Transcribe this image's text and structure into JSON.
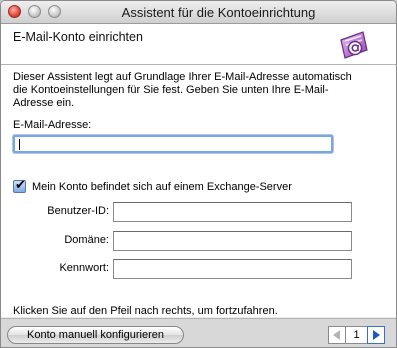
{
  "window": {
    "title": "Assistent für die Kontoeinrichtung"
  },
  "header": {
    "title": "E-Mail-Konto einrichten",
    "logo_icon": "entourage-logo-icon"
  },
  "content": {
    "description": "Dieser Assistent legt auf Grundlage Ihrer E-Mail-Adresse automatisch die Kontoeinstellungen für Sie fest. Geben Sie unten Ihre E-Mail-Adresse ein.",
    "email_label": "E-Mail-Adresse:",
    "email_value": "",
    "exchange_checkbox": {
      "label": "Mein Konto befindet sich auf einem Exchange-Server",
      "checked": true
    },
    "fields": [
      {
        "label": "Benutzer-ID:",
        "value": ""
      },
      {
        "label": "Domäne:",
        "value": ""
      },
      {
        "label": "Kennwort:",
        "value": ""
      }
    ],
    "hint": "Klicken Sie auf den Pfeil nach rechts, um fortzufahren."
  },
  "footer": {
    "manual_button": "Konto manuell konfigurieren",
    "page_number": "1"
  },
  "colors": {
    "focus_ring": "#7aa6de",
    "next_arrow": "#1c56c4"
  }
}
